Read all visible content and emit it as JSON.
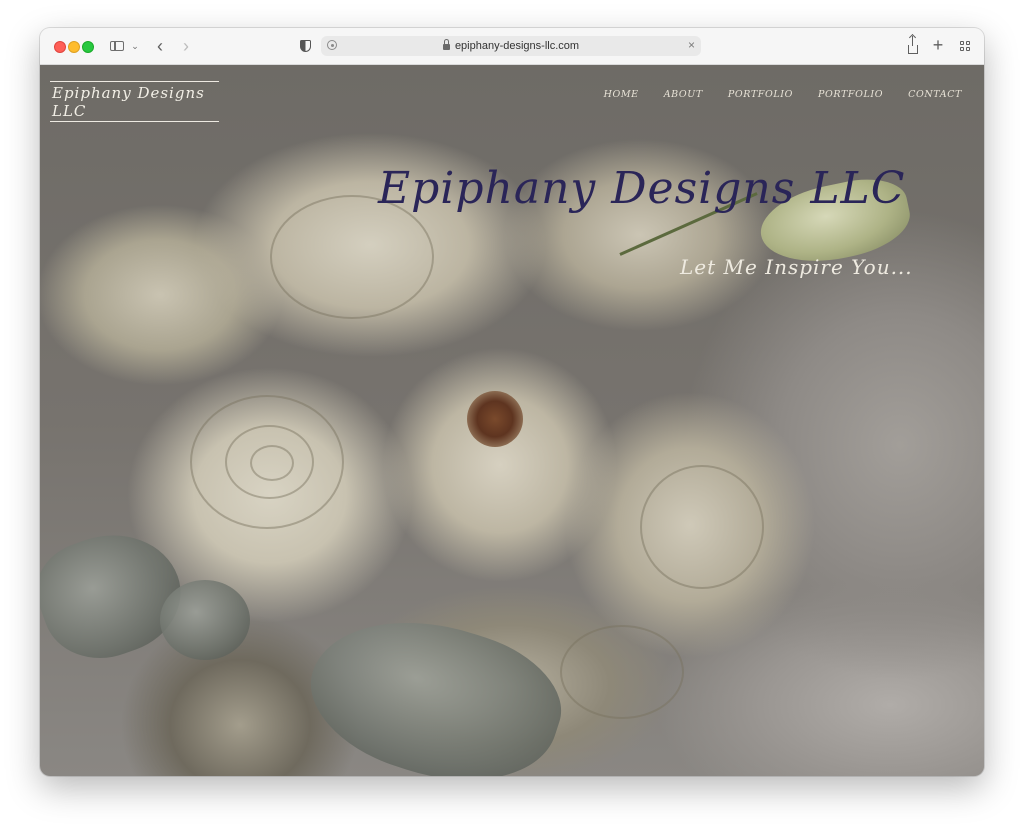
{
  "browser": {
    "url": "epiphany-designs-llc.com",
    "icons": [
      "sidebar-icon",
      "chevron-down-icon",
      "back-arrow-icon",
      "forward-arrow-icon",
      "shield-icon",
      "extension-icon",
      "lock-icon",
      "close-icon",
      "share-icon",
      "plus-icon",
      "tab-overview-icon"
    ],
    "back_glyph": "‹",
    "forward_glyph": "›",
    "chevron_glyph": "⌄",
    "close_glyph": "×",
    "newtab_glyph": "+"
  },
  "site": {
    "logo": "Epiphany Designs LLC",
    "nav": [
      "HOME",
      "ABOUT",
      "PORTFOLIO",
      "PORTFOLIO",
      "CONTACT"
    ],
    "hero_title": "Epiphany Designs LLC",
    "hero_subtitle": "Let Me Inspire You..."
  },
  "colors": {
    "hero_title": "#2a2558",
    "hero_subtitle": "#eeeae0",
    "nav_text": "#e7e2d6"
  }
}
